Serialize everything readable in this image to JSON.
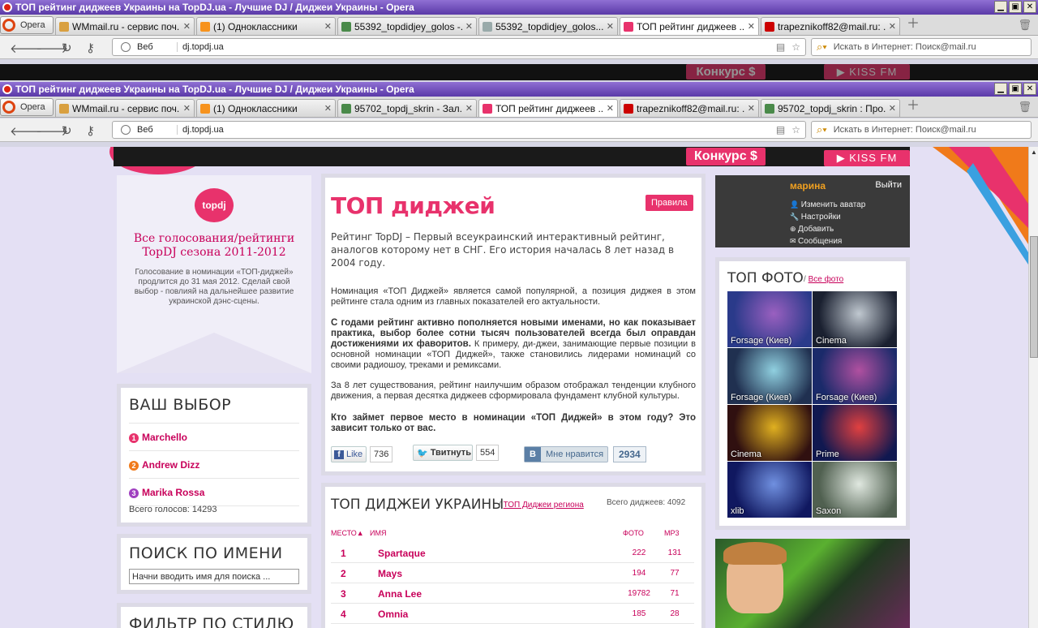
{
  "window1": {
    "title": "ТОП рейтинг диджеев Украины на TopDJ.ua - Лучшие DJ / Диджеи Украины - Opera",
    "opera_label": "Opera",
    "tabs": [
      {
        "label": "WMmail.ru - сервис поч...",
        "fav": "#d9a040"
      },
      {
        "label": "(1) Одноклассники",
        "fav": "#f7931e"
      },
      {
        "label": "55392_topdidjey_golos -...",
        "fav": "#4a8a4a"
      },
      {
        "label": "55392_topdidjey_golos....",
        "fav": "#9aa"
      },
      {
        "label": "ТОП рейтинг диджеев ...",
        "fav": "#e8326c"
      },
      {
        "label": "trapeznikoff82@mail.ru: ...",
        "fav": "#c00"
      }
    ],
    "address": {
      "web_label": "Веб",
      "url": "dj.topdj.ua",
      "search_placeholder": "Искать в Интернет: Поиск@mail.ru"
    }
  },
  "window2": {
    "title": "ТОП рейтинг диджеев Украины на TopDJ.ua - Лучшие DJ / Диджеи Украины - Opera",
    "opera_label": "Opera",
    "tabs": [
      {
        "label": "WMmail.ru - сервис поч...",
        "fav": "#d9a040"
      },
      {
        "label": "(1) Одноклассники",
        "fav": "#f7931e"
      },
      {
        "label": "95702_topdj_skrin - Зал...",
        "fav": "#4a8a4a"
      },
      {
        "label": "ТОП рейтинг диджеев ...",
        "fav": "#e8326c"
      },
      {
        "label": "trapeznikoff82@mail.ru: ...",
        "fav": "#c00"
      },
      {
        "label": "95702_topdj_skrin : Про...",
        "fav": "#4a8a4a"
      }
    ],
    "address": {
      "web_label": "Веб",
      "url": "dj.topdj.ua",
      "search_placeholder": "Искать в Интернет: Поиск@mail.ru"
    }
  },
  "header": {
    "konkurs": "Конкурс $",
    "kissfm": "KISS FM"
  },
  "promo": {
    "logo_text": "topdj",
    "title": "Все голосования/рейтинги TopDJ сезона 2011-2012",
    "text": "Голосование в номинации «ТОП-диджей» продлится до 31 мая 2012. Сделай свой выбор - повлияй на дальнейшее развитие украинской дэнс-сцены."
  },
  "choice": {
    "title": "ВАШ ВЫБОР",
    "items": [
      {
        "num": "1",
        "name": "Marchello",
        "color": "#e8326c"
      },
      {
        "num": "2",
        "name": "Andrew Dizz",
        "color": "#f07a1a"
      },
      {
        "num": "3",
        "name": "Marika Rossa",
        "color": "#a040c0"
      }
    ],
    "total": "Всего голосов: 14293"
  },
  "search": {
    "title": "ПОИСК ПО ИМЕНИ",
    "placeholder": "Начни вводить имя для поиска ..."
  },
  "filter": {
    "title": "ФИЛЬТР ПО СТИЛЮ"
  },
  "main": {
    "title": "ТОП диджей",
    "rules": "Правила",
    "lead": "Рейтинг TopDJ – Первый всеукраинский интерактивный рейтинг, аналогов которому нет в СНГ. Его история началась 8 лет назад в 2004 году.",
    "p1": "Номинация «ТОП Диджей» является самой популярной, а позиция диджея в этом рейтинге стала одним из главных показателей его актуальности.",
    "p2_bold": "С годами рейтинг активно пополняется новыми именами, но как показывает практика, выбор более сотни тысяч пользователей всегда был оправдан достижениями их фаворитов.",
    "p2_rest": " К примеру, ди-джеи, занимающие первые позиции в основной номинации «ТОП Диджей», также становились лидерами номинаций со своими радиошоу, треками и ремиксами.",
    "p3": "За 8 лет существования, рейтинг наилучшим образом отображал тенденции клубного движения, а первая десятка диджеев сформировала фундамент клубной культуры.",
    "p4": "Кто займет первое место в номинации «ТОП Диджей» в этом году? Это зависит только от вас.",
    "social": {
      "fb": "Like",
      "fb_count": "736",
      "tw": "Твитнуть",
      "tw_count": "554",
      "vk": "Мне нравится",
      "vk_count": "2934"
    }
  },
  "ranking": {
    "title": "ТОП ДИДЖЕИ УКРАИНЫ",
    "region_link": "ТОП Диджеи региона",
    "total": "Всего диджеев: 4092",
    "headers": {
      "place": "МЕСТО",
      "name": "ИМЯ",
      "photo": "ФОТО",
      "mp3": "MP3"
    },
    "rows": [
      {
        "place": "1",
        "name": "Spartaque",
        "photo": "222",
        "mp3": "131"
      },
      {
        "place": "2",
        "name": "Mays",
        "photo": "194",
        "mp3": "77"
      },
      {
        "place": "3",
        "name": "Anna Lee",
        "photo": "19782",
        "mp3": "71"
      },
      {
        "place": "4",
        "name": "Omnia",
        "photo": "185",
        "mp3": "28"
      }
    ]
  },
  "user": {
    "name": "марина",
    "logout": "Выйти",
    "links": [
      "Изменить аватар",
      "Настройки",
      "Добавить",
      "Сообщения"
    ]
  },
  "topphoto": {
    "title": "ТОП ФОТО",
    "all": "Все фото",
    "photos": [
      {
        "cap": "Forsage (Киев)",
        "c1": "#2a3a8a",
        "c2": "#9a60c0"
      },
      {
        "cap": "Cinema",
        "c1": "#1a2030",
        "c2": "#c0c8d0"
      },
      {
        "cap": "Forsage (Киев)",
        "c1": "#203050",
        "c2": "#90d0e0"
      },
      {
        "cap": "Forsage (Киев)",
        "c1": "#1a2a6a",
        "c2": "#b050a0"
      },
      {
        "cap": "Cinema",
        "c1": "#301010",
        "c2": "#e0b020"
      },
      {
        "cap": "Prime",
        "c1": "#101850",
        "c2": "#e04040"
      },
      {
        "cap": "xlib",
        "c1": "#101860",
        "c2": "#7090e0"
      },
      {
        "cap": "Saxon",
        "c1": "#506050",
        "c2": "#e0e8e0"
      }
    ]
  },
  "colors": {
    "accent": "#e8326c",
    "link": "#c8005a"
  }
}
